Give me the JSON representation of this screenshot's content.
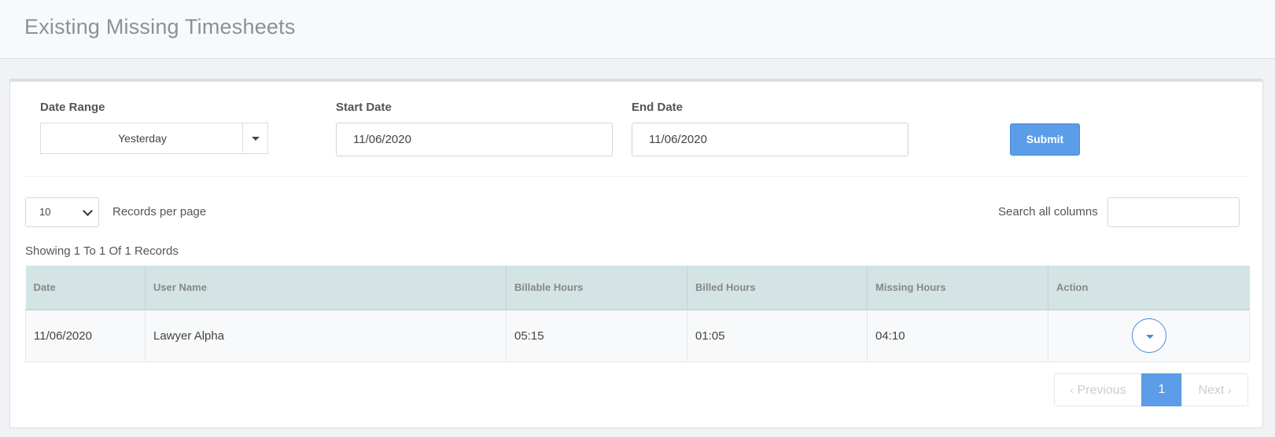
{
  "page": {
    "title": "Existing Missing Timesheets"
  },
  "filters": {
    "date_range_label": "Date Range",
    "date_range_value": "Yesterday",
    "start_date_label": "Start Date",
    "start_date_value": "11/06/2020",
    "end_date_label": "End Date",
    "end_date_value": "11/06/2020",
    "submit_label": "Submit"
  },
  "table_controls": {
    "per_page_value": "10",
    "per_page_label": "Records per page",
    "search_label": "Search all columns",
    "search_value": "",
    "records_info": "Showing 1 To 1 Of 1 Records"
  },
  "table": {
    "headers": [
      "Date",
      "User Name",
      "Billable Hours",
      "Billed Hours",
      "Missing Hours",
      "Action"
    ],
    "rows": [
      {
        "date": "11/06/2020",
        "user_name": "Lawyer Alpha",
        "billable_hours": "05:15",
        "billed_hours": "01:05",
        "missing_hours": "04:10"
      }
    ]
  },
  "pagination": {
    "previous_label": "Previous",
    "current_page": "1",
    "next_label": "Next"
  },
  "colors": {
    "accent": "#5b9de8",
    "table_header_bg": "#d4e3e3"
  }
}
